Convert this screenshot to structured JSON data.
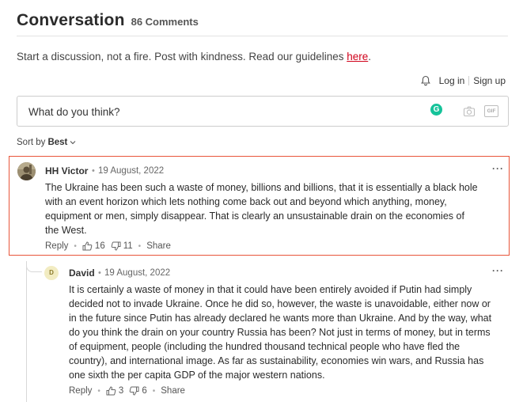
{
  "header": {
    "title": "Conversation",
    "count": "86 Comments"
  },
  "guidelines": {
    "text": "Start a discussion, not a fire. Post with kindness. Read our guidelines ",
    "link": "here",
    "end": "."
  },
  "auth": {
    "login": "Log in",
    "signup": "Sign up"
  },
  "composer": {
    "placeholder": "What do you think?",
    "grammarly": "G",
    "gif": "GIF"
  },
  "sort": {
    "label": "Sort by",
    "value": "Best"
  },
  "comments": [
    {
      "author": "HH Victor",
      "date": "19 August, 2022",
      "lines": [
        "The Ukraine has been such a waste of money, billions and billions, that it is essentially a black hole",
        "with an event horizon which lets nothing come back out and beyond which anything, money,",
        "equipment or men, simply disappear.  That is clearly an unsustainable drain on the economies of",
        "the West."
      ],
      "reply": "Reply",
      "likes": "16",
      "dislikes": "11",
      "share": "Share",
      "more": "···"
    },
    {
      "author": "David",
      "avatar_letter": "D",
      "date": "19 August, 2022",
      "lines": [
        "It is certainly a waste of money in that it could have been entirely avoided if Putin had simply",
        "decided not to invade Ukraine.  Once he did so, however, the waste is unavoidable, either now or",
        "in the future since Putin has already declared he wants more than Ukraine.  And by the way, what",
        "do you think the drain on your country Russia has been?  Not just in terms of money, but in terms",
        "of equipment, people (including the hundred thousand technical people who have fled the",
        "country), and international image.  As far as sustainability, economies win wars, and Russia has",
        "one sixth the per capita GDP of the major western nations."
      ],
      "reply": "Reply",
      "likes": "3",
      "dislikes": "6",
      "share": "Share",
      "more": "···"
    }
  ],
  "colors": {
    "link_red": "#d0021b",
    "highlight_border": "#e8553a",
    "grammarly_green": "#15c39a"
  }
}
